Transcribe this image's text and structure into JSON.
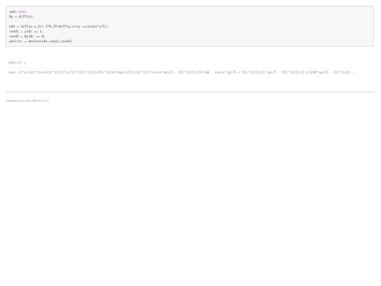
{
  "code": {
    "line1_cmd": "syms ",
    "line1_arg": "y(x)",
    "line2": "Dy = diff(y);",
    "line3": "",
    "line4": "ode = diff(y,x,2)+ 2*0.25*diff(y,x)+y ==sin(pi*x/5);",
    "line5": "cond1 = y(0) == 1;",
    "line6": "cond2 = Dy(0) == 0;",
    "line7": "ySol(x) = dsolve(ode,cond1,cond2)"
  },
  "output": {
    "label": "ySol(x) =",
    "expression": "exp(-(2^x)/2)(^sin((15)^(1/2)*x)/2)*(15)^(1/2)/25)^(1/2)*exp((2*x)/2)^(1/2*sin(x*(pi/5 - 15)^(1/2)/2))/30 - cos(x*(pi/5 + 15)^(1/2)/2)*(pi/5 - 15)^(1/2)/2))/(150*(pi/5 - 15)^(1/2)..."
  },
  "footer": {
    "text": "Published with MATLAB® R2017a"
  }
}
